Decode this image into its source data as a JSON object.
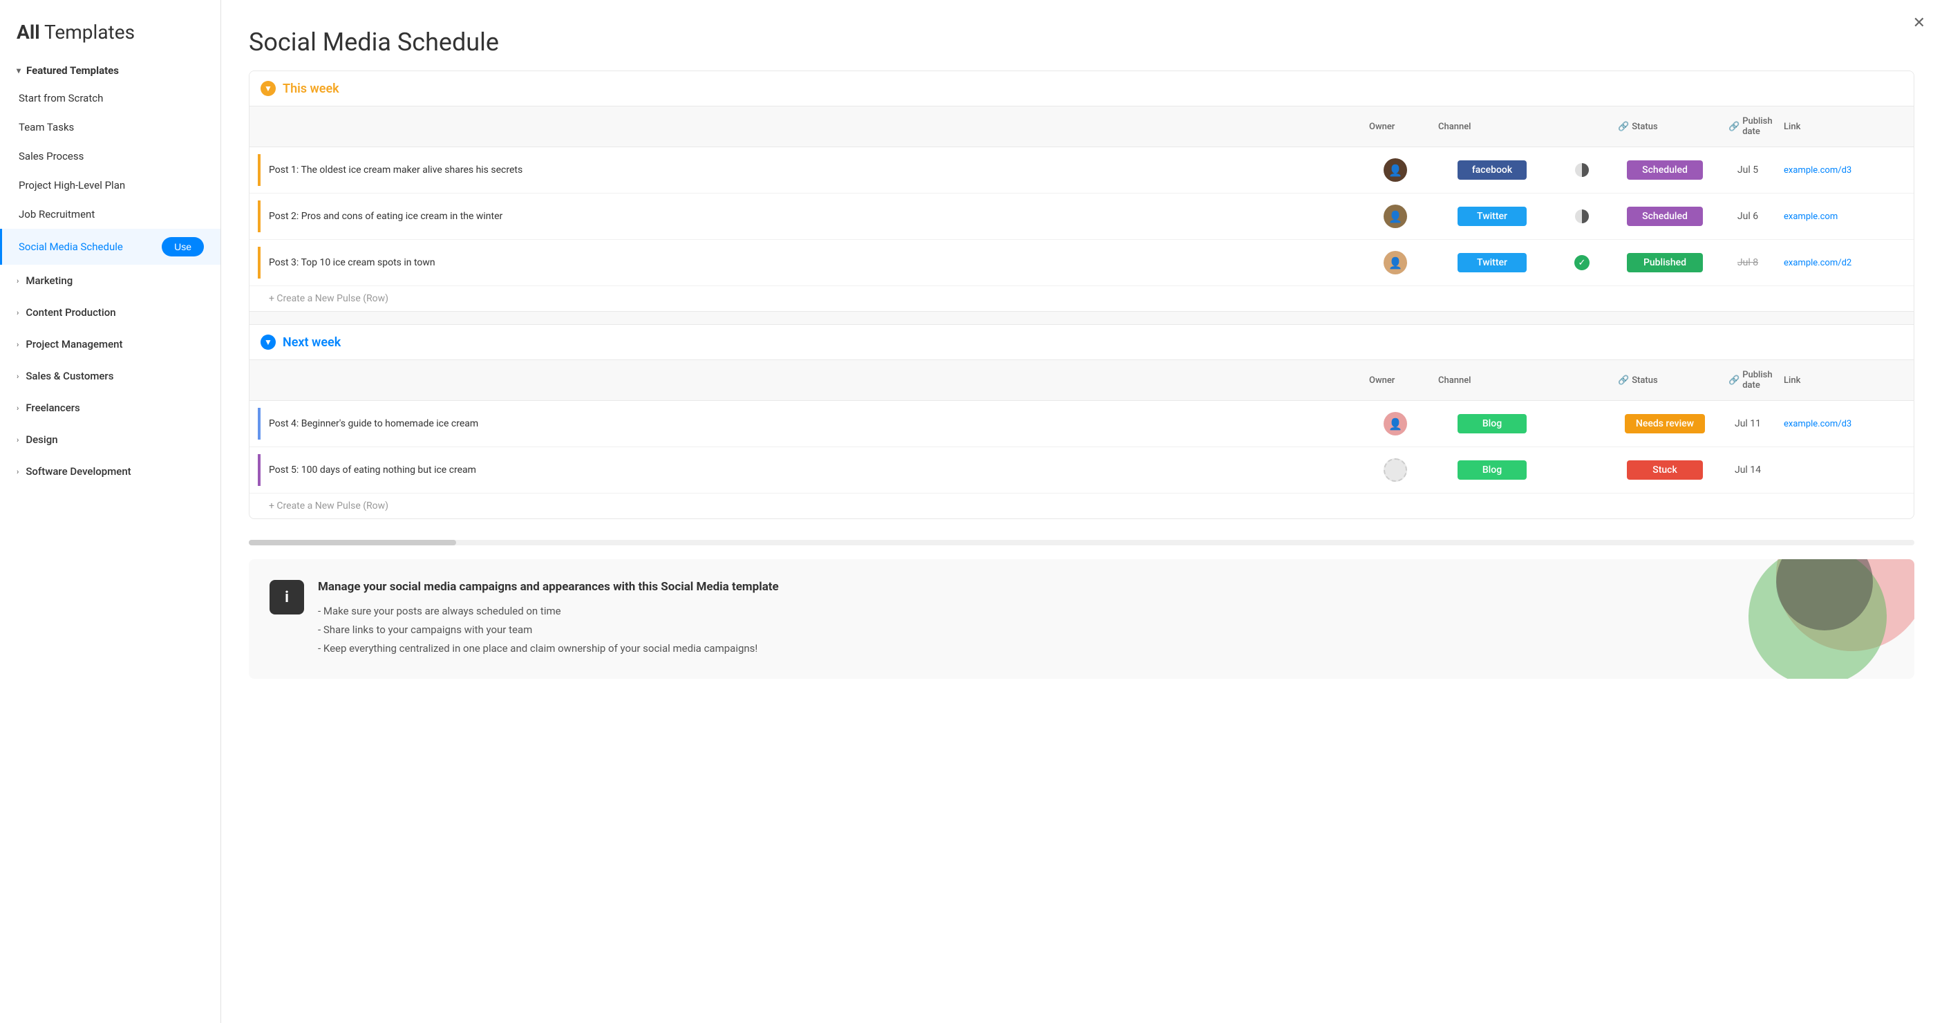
{
  "sidebar": {
    "title_bold": "All",
    "title_rest": " Templates",
    "featured": {
      "label": "Featured Templates",
      "items": [
        {
          "id": "start-scratch",
          "label": "Start from Scratch"
        },
        {
          "id": "team-tasks",
          "label": "Team Tasks"
        },
        {
          "id": "sales-process",
          "label": "Sales Process"
        },
        {
          "id": "project-plan",
          "label": "Project High-Level Plan"
        },
        {
          "id": "job-recruitment",
          "label": "Job Recruitment"
        },
        {
          "id": "social-media",
          "label": "Social Media Schedule",
          "active": true
        }
      ]
    },
    "categories": [
      {
        "id": "marketing",
        "label": "Marketing"
      },
      {
        "id": "content-production",
        "label": "Content Production"
      },
      {
        "id": "project-management",
        "label": "Project Management"
      },
      {
        "id": "sales-customers",
        "label": "Sales & Customers"
      },
      {
        "id": "freelancers",
        "label": "Freelancers"
      },
      {
        "id": "design",
        "label": "Design"
      },
      {
        "id": "software-dev",
        "label": "Software Development"
      }
    ],
    "use_button_label": "Use"
  },
  "main": {
    "close_label": "✕",
    "title": "Social Media Schedule",
    "groups": [
      {
        "id": "this-week",
        "label": "This week",
        "color": "yellow",
        "icon": "▼",
        "columns": [
          "",
          "Owner",
          "Channel",
          "",
          "Status",
          "Publish date",
          "Link"
        ],
        "rows": [
          {
            "name": "Post 1: The oldest ice cream maker alive shares his secrets",
            "owner_color": "dark",
            "channel": "facebook",
            "channel_label": "facebook",
            "status_indicator": "half",
            "status": "Scheduled",
            "status_class": "scheduled",
            "date": "Jul 5",
            "date_strikethrough": false,
            "link": "example.com/d3"
          },
          {
            "name": "Post 2: Pros and cons of eating ice cream in the winter",
            "owner_color": "medium",
            "channel": "twitter",
            "channel_label": "Twitter",
            "status_indicator": "half",
            "status": "Scheduled",
            "status_class": "scheduled",
            "date": "Jul 6",
            "date_strikethrough": false,
            "link": "example.com"
          },
          {
            "name": "Post 3: Top 10 ice cream spots in town",
            "owner_color": "light",
            "channel": "twitter",
            "channel_label": "Twitter",
            "status_indicator": "check",
            "status": "Published",
            "status_class": "published",
            "date": "Jul 8",
            "date_strikethrough": true,
            "link": "example.com/d2"
          }
        ],
        "create_label": "+ Create a New Pulse (Row)"
      },
      {
        "id": "next-week",
        "label": "Next week",
        "color": "blue",
        "icon": "▼",
        "columns": [
          "",
          "Owner",
          "Channel",
          "",
          "Status",
          "Publish date",
          "Link"
        ],
        "rows": [
          {
            "name": "Post 4: Beginner's guide to homemade ice cream",
            "owner_color": "pink",
            "channel": "blog",
            "channel_label": "Blog",
            "status_indicator": "none",
            "status": "Needs review",
            "status_class": "needs-review",
            "date": "Jul 11",
            "date_strikethrough": false,
            "link": "example.com/d3"
          },
          {
            "name": "Post 5: 100 days of eating nothing but ice cream",
            "owner_color": "empty",
            "channel": "blog",
            "channel_label": "Blog",
            "status_indicator": "none",
            "status": "Stuck",
            "status_class": "stuck",
            "date": "Jul 14",
            "date_strikethrough": false,
            "link": ""
          }
        ],
        "create_label": "+ Create a New Pulse (Row)"
      }
    ],
    "info": {
      "icon": "i",
      "title": "Manage your social media campaigns and appearances with this Social Media template",
      "bullets": [
        "- Make sure your posts are always scheduled on time",
        "- Share links to your campaigns with your team",
        "- Keep everything centralized in one place and claim ownership of your social media campaigns!"
      ]
    }
  }
}
